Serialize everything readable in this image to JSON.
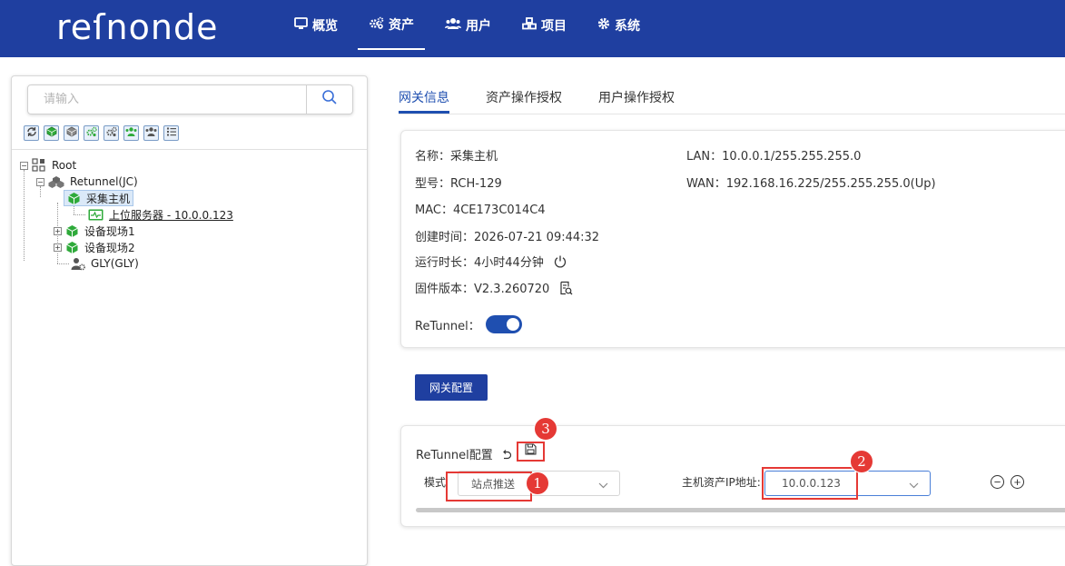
{
  "app": {
    "logo_text": "reſnonde",
    "brand_color": "#1f3fa0",
    "accent_color": "#1f4fb0",
    "annotation_color": "#e53935"
  },
  "nav": {
    "items": [
      {
        "label": "概览",
        "icon": "monitor-icon"
      },
      {
        "label": "资产",
        "icon": "cogs-icon",
        "active": true
      },
      {
        "label": "用户",
        "icon": "users-icon"
      },
      {
        "label": "项目",
        "icon": "cubes-icon"
      },
      {
        "label": "系统",
        "icon": "gear-icon"
      }
    ]
  },
  "sidebar": {
    "search": {
      "placeholder": "请输入",
      "icon": "search-icon"
    },
    "toolbar_icons": [
      "refresh-icon",
      "add-node-icon",
      "node-icon",
      "group-settings-icon",
      "settings-icon",
      "users-add-icon",
      "users-icon",
      "list-icon"
    ],
    "tree": [
      {
        "label": "Root",
        "icon": "root-icon"
      },
      {
        "label": "Retunnel(JC)",
        "icon": "cluster-icon"
      },
      {
        "label": "采集主机",
        "icon": "gateway-icon",
        "selected": true
      },
      {
        "label": "上位服务器 - 10.0.0.123",
        "icon": "server-icon"
      },
      {
        "label": "设备现场1",
        "icon": "gateway-icon"
      },
      {
        "label": "设备现场2",
        "icon": "gateway-icon"
      },
      {
        "label": "GLY(GLY)",
        "icon": "user-settings-icon"
      }
    ]
  },
  "tabs": [
    {
      "label": "网关信息",
      "active": true
    },
    {
      "label": "资产操作授权"
    },
    {
      "label": "用户操作授权"
    }
  ],
  "info": {
    "name": "名称：采集主机",
    "model": "型号：RCH-129",
    "mac": "MAC：4CE173C014C4",
    "created": "创建时间：2026-07-21 09:44:32",
    "uptime": "运行时长：4小时44分钟",
    "firmware": "固件版本：V2.3.260720",
    "lan": "LAN：10.0.0.1/255.255.255.0",
    "wan": "WAN：192.168.16.225/255.255.255.0(Up)",
    "retunnel_label": "ReTunnel：",
    "retunnel_enabled": true
  },
  "gateway_config_button": "网关配置",
  "retunnel_config": {
    "title": "ReTunnel配置",
    "mode_label": "模式",
    "mode_value": "站点推送",
    "host_ip_label": "主机资产IP地址:",
    "host_ip_value": "10.0.0.123",
    "minus": "−",
    "plus": "+"
  },
  "annotations": [
    "1",
    "2",
    "3"
  ]
}
